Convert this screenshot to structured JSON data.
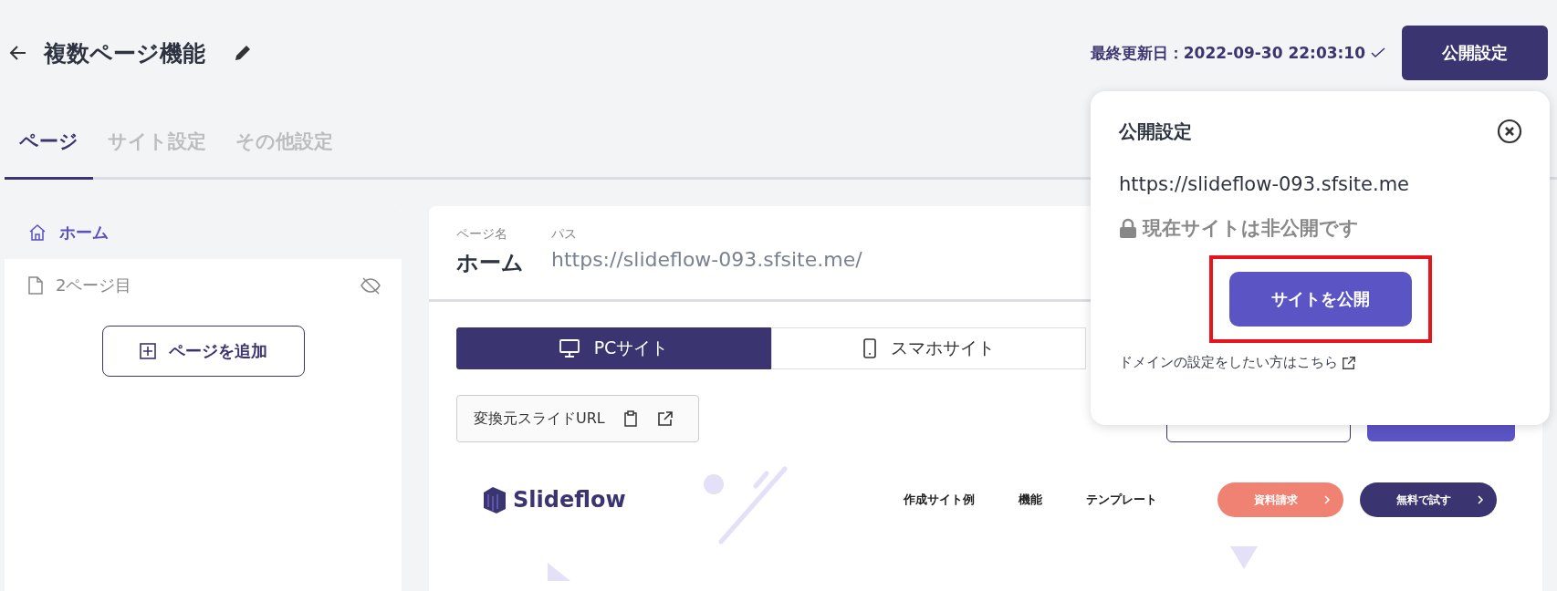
{
  "header": {
    "title": "複数ページ機能",
    "last_updated": "最終更新日：2022-09-30 22:03:10",
    "publish_settings_button": "公開設定"
  },
  "tabs": [
    {
      "label": "ページ",
      "selected": true
    },
    {
      "label": "サイト設定",
      "selected": false
    },
    {
      "label": "その他設定",
      "selected": false
    }
  ],
  "sidebar": {
    "pages": [
      {
        "label": "ホーム",
        "kind": "home",
        "selected": true,
        "hidden": false
      },
      {
        "label": "2ページ目",
        "kind": "file",
        "selected": false,
        "hidden": true
      }
    ],
    "add_page_button": "ページを追加"
  },
  "page_panel": {
    "name_label": "ページ名",
    "path_label": "パス",
    "name": "ホーム",
    "path": "https://slideflow-093.sfsite.me/",
    "device_tabs": [
      {
        "label": "PCサイト",
        "kind": "pc",
        "selected": true
      },
      {
        "label": "スマホサイト",
        "kind": "mobile",
        "selected": false
      }
    ],
    "source_url_button": "変換元スライドURL",
    "preview": {
      "logo": "Slideflow",
      "nav": [
        "作成サイト例",
        "機能",
        "テンプレート"
      ],
      "cta": [
        {
          "label": "資料請求",
          "kind": "secondary"
        },
        {
          "label": "無料で試す",
          "kind": "primary"
        }
      ]
    }
  },
  "popup": {
    "title": "公開設定",
    "url": "https://slideflow-093.sfsite.me",
    "status": "現在サイトは非公開です",
    "publish_button": "サイトを公開",
    "highlighted": true,
    "domain_link": "ドメインの設定をしたい方はこちら"
  }
}
